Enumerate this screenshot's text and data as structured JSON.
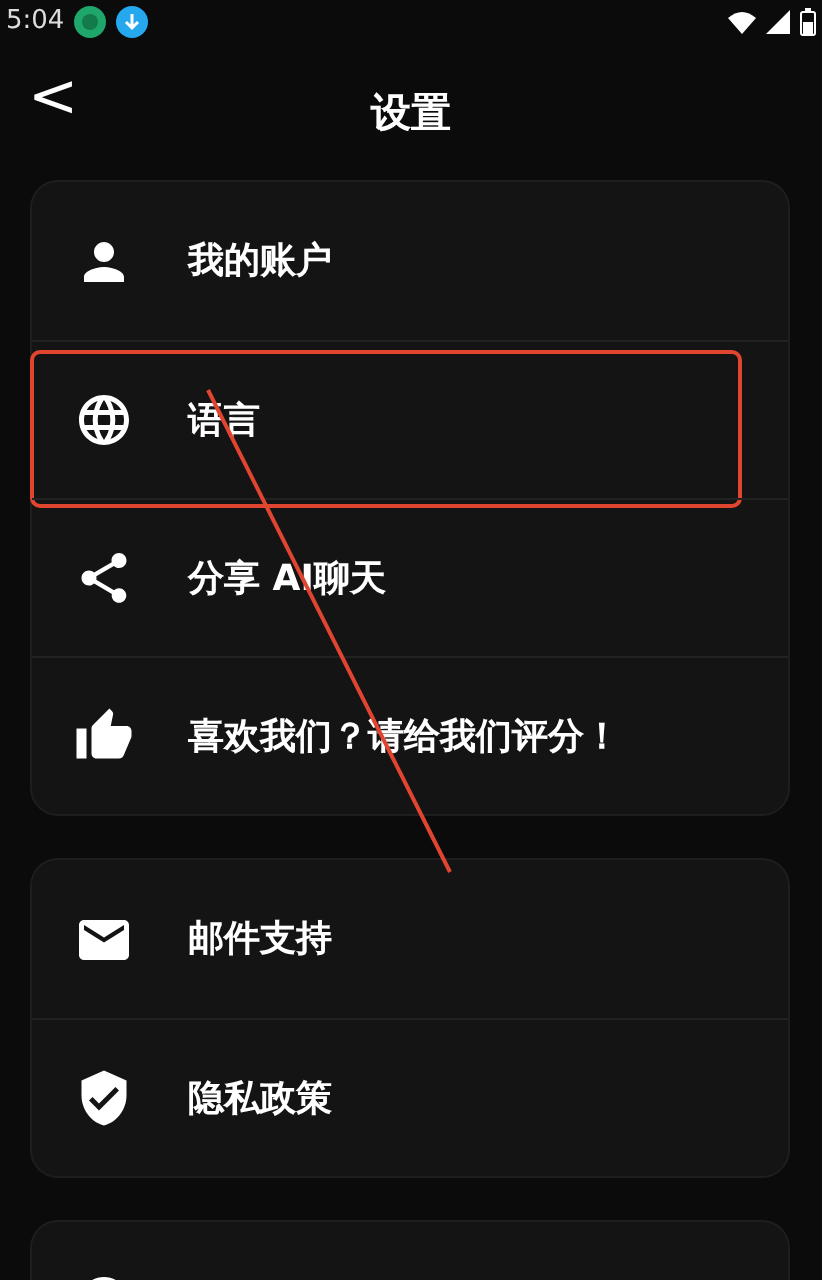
{
  "status_bar": {
    "time": "5:04"
  },
  "header": {
    "back": "<",
    "title": "设置"
  },
  "groups": [
    {
      "items": [
        {
          "kind": "account",
          "label": "我的账户",
          "highlighted": false
        },
        {
          "kind": "language",
          "label": "语言",
          "highlighted": true
        },
        {
          "kind": "share",
          "label": "分享 AI聊天",
          "highlighted": false
        },
        {
          "kind": "rate",
          "label": "喜欢我们？请给我们评分！",
          "highlighted": false
        }
      ]
    },
    {
      "items": [
        {
          "kind": "mail",
          "label": "邮件支持",
          "highlighted": false
        },
        {
          "kind": "privacy",
          "label": "隐私政策",
          "highlighted": false
        }
      ]
    },
    {
      "items": [
        {
          "kind": "about",
          "highlighted": false
        }
      ]
    }
  ]
}
